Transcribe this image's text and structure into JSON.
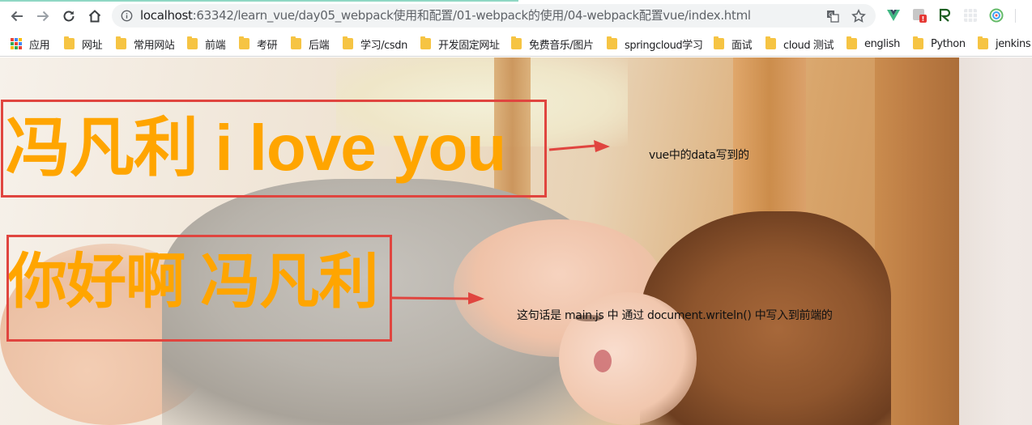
{
  "browser": {
    "url_scheme": "",
    "url_host": "localhost",
    "url_path": ":63342/learn_vue/day05_webpack使用和配置/01-webpack的使用/04-webpack配置vue/index.html",
    "buttons": [
      "back-icon",
      "forward-icon",
      "reload-icon",
      "home-icon"
    ],
    "extensions": [
      "vue-devtools-icon",
      "ext-badge-icon",
      "ext-r-icon",
      "ext-grid-icon",
      "ext-circle-icon"
    ]
  },
  "bookmarks": [
    {
      "label": "应用",
      "icon": "apps-grid-icon"
    },
    {
      "label": "网址",
      "icon": "folder-icon"
    },
    {
      "label": "常用网站",
      "icon": "folder-icon"
    },
    {
      "label": "前端",
      "icon": "folder-icon"
    },
    {
      "label": "考研",
      "icon": "folder-icon"
    },
    {
      "label": "后端",
      "icon": "folder-icon"
    },
    {
      "label": "学习/csdn",
      "icon": "folder-icon"
    },
    {
      "label": "开发固定网址",
      "icon": "folder-icon"
    },
    {
      "label": "免费音乐/图片",
      "icon": "folder-icon"
    },
    {
      "label": "springcloud学习",
      "icon": "folder-icon"
    },
    {
      "label": "面试",
      "icon": "folder-icon"
    },
    {
      "label": "cloud 测试",
      "icon": "folder-icon"
    },
    {
      "label": "english",
      "icon": "folder-icon"
    },
    {
      "label": "Python",
      "icon": "folder-icon"
    },
    {
      "label": "jenkins",
      "icon": "folder-icon"
    }
  ],
  "page": {
    "heading1": "冯凡利 i love you",
    "heading2": "你好啊 冯凡利",
    "annotation1": "vue中的data写到的",
    "annotation2": "这句话是 main.js  中 通过 document.writeln() 中写入到前端的"
  },
  "colors": {
    "accent_text": "#ffa500",
    "annotation_red": "#e0453f"
  }
}
